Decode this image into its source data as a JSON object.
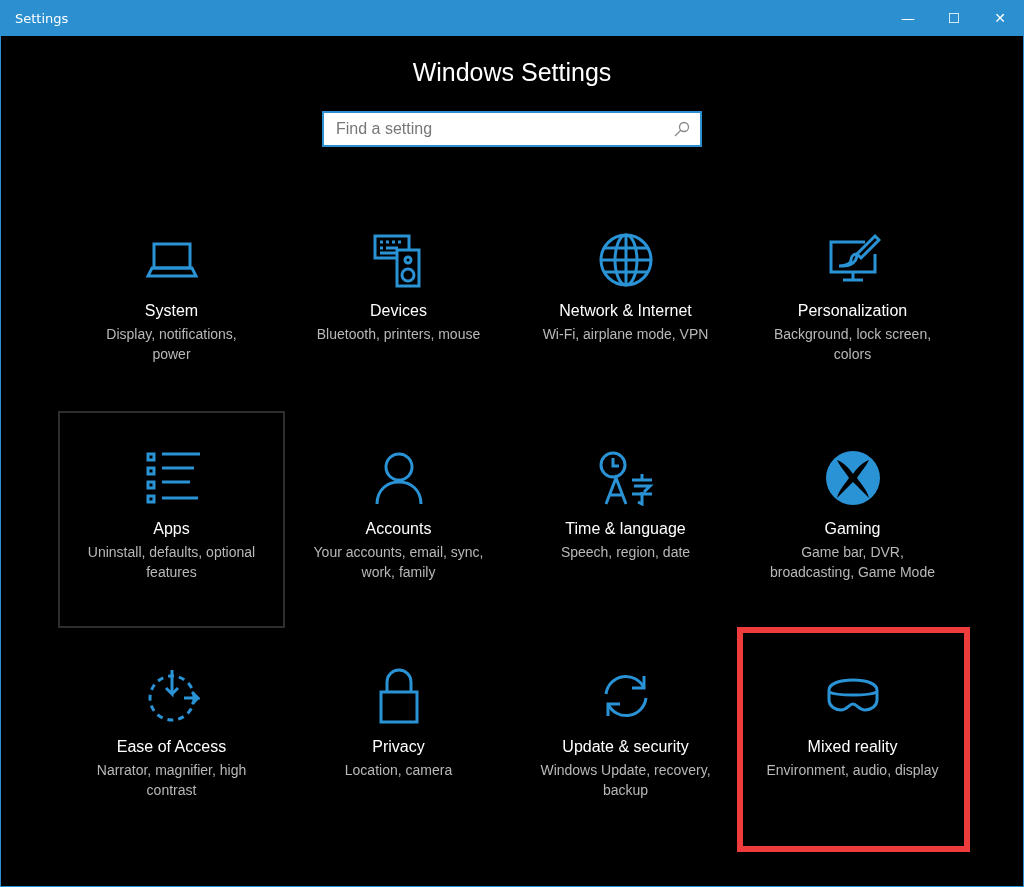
{
  "window": {
    "title": "Settings",
    "controls": [
      "—",
      "☐",
      "✕"
    ]
  },
  "heading": "Windows Settings",
  "search": {
    "placeholder": "Find a setting"
  },
  "tiles": [
    {
      "kind": "system",
      "title": "System",
      "description": "Display, notifications, power",
      "hovered": false,
      "highlighted": false
    },
    {
      "kind": "devices",
      "title": "Devices",
      "description": "Bluetooth, printers, mouse",
      "hovered": false,
      "highlighted": false
    },
    {
      "kind": "network",
      "title": "Network & Internet",
      "description": "Wi-Fi, airplane mode, VPN",
      "hovered": false,
      "highlighted": false
    },
    {
      "kind": "personalization",
      "title": "Personalization",
      "description": "Background, lock screen, colors",
      "hovered": false,
      "highlighted": false
    },
    {
      "kind": "apps",
      "title": "Apps",
      "description": "Uninstall, defaults, optional features",
      "hovered": true,
      "highlighted": false
    },
    {
      "kind": "accounts",
      "title": "Accounts",
      "description": "Your accounts, email, sync, work, family",
      "hovered": false,
      "highlighted": false
    },
    {
      "kind": "time",
      "title": "Time & language",
      "description": "Speech, region, date",
      "hovered": false,
      "highlighted": false
    },
    {
      "kind": "gaming",
      "title": "Gaming",
      "description": "Game bar, DVR, broadcasting, Game Mode",
      "hovered": false,
      "highlighted": false
    },
    {
      "kind": "ease",
      "title": "Ease of Access",
      "description": "Narrator, magnifier, high contrast",
      "hovered": false,
      "highlighted": false
    },
    {
      "kind": "privacy",
      "title": "Privacy",
      "description": "Location, camera",
      "hovered": false,
      "highlighted": false
    },
    {
      "kind": "update",
      "title": "Update & security",
      "description": "Windows Update, recovery, backup",
      "hovered": false,
      "highlighted": false
    },
    {
      "kind": "mixed",
      "title": "Mixed reality",
      "description": "Environment, audio, display",
      "hovered": false,
      "highlighted": true
    }
  ]
}
